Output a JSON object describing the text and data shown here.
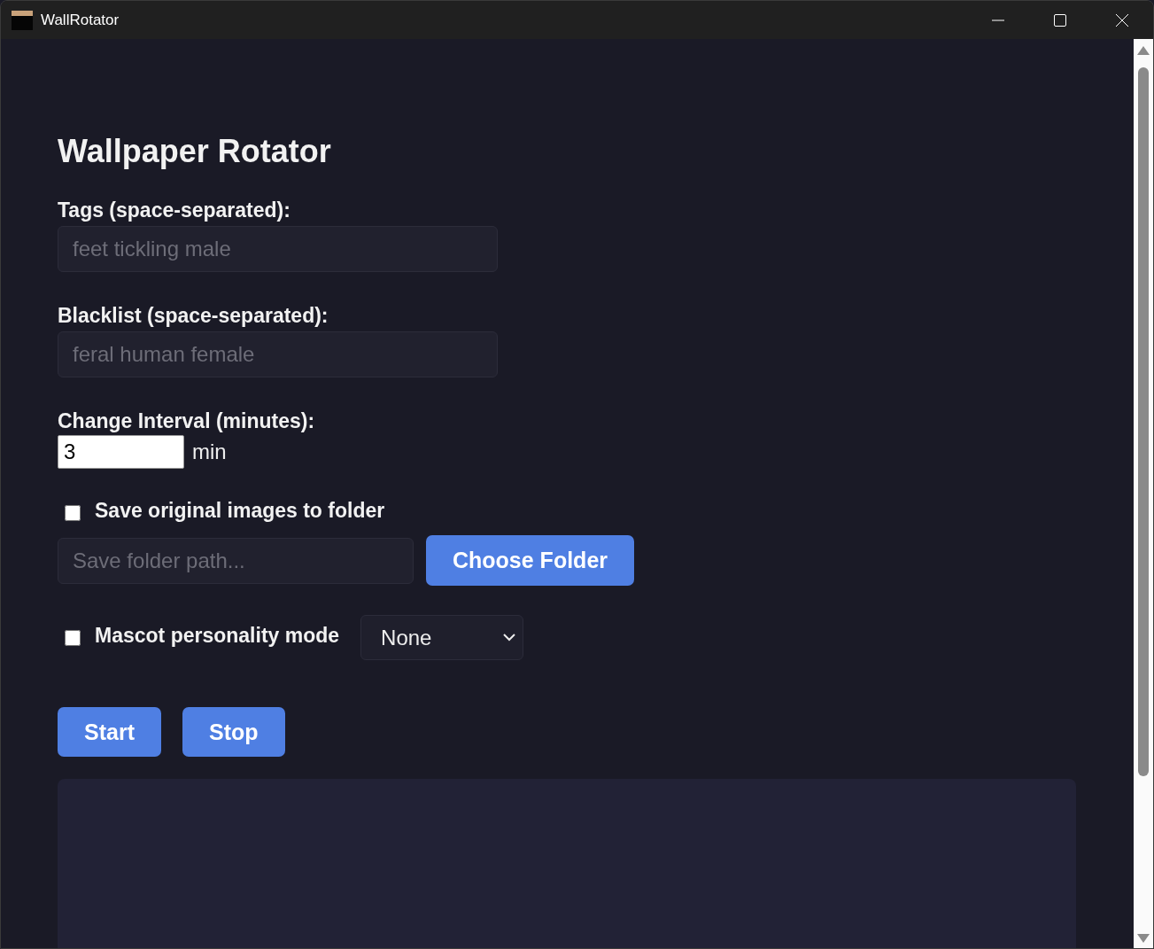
{
  "window": {
    "title": "WallRotator"
  },
  "heading": "Wallpaper Rotator",
  "tags": {
    "label": "Tags (space-separated):",
    "placeholder": "feet tickling male"
  },
  "blacklist": {
    "label": "Blacklist (space-separated):",
    "placeholder": "feral human female"
  },
  "interval": {
    "label": "Change Interval (minutes):",
    "value": "3",
    "unit": "min"
  },
  "save_originals": {
    "label": "Save original images to folder",
    "checked": false,
    "placeholder": "Save folder path...",
    "button": "Choose Folder"
  },
  "mascot": {
    "label": "Mascot personality mode",
    "checked": false,
    "value": "None"
  },
  "buttons": [
    "Start",
    "Stop"
  ]
}
